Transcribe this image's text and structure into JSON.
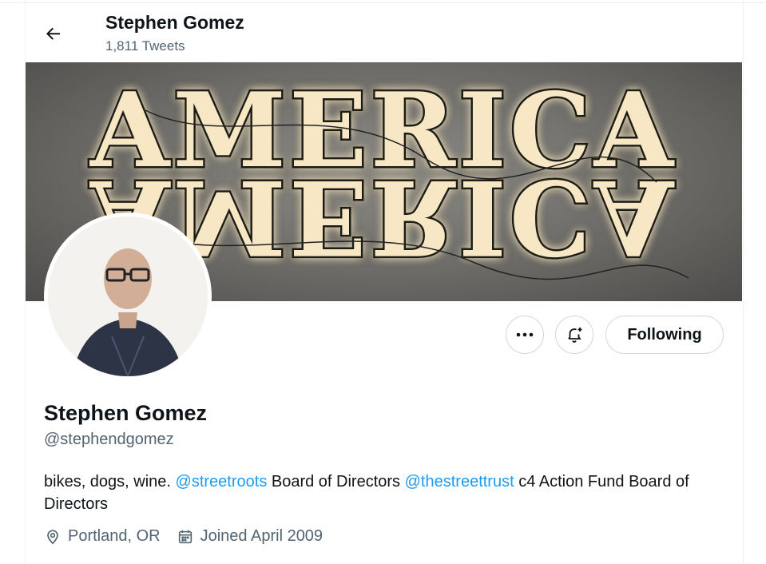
{
  "header": {
    "name": "Stephen Gomez",
    "tweet_count": "1,811 Tweets",
    "back_icon": "arrow-left-icon"
  },
  "banner": {
    "description_text_top": "AMERICA",
    "description_text_bottom": "AMERICA"
  },
  "actions": {
    "more_icon": "ellipsis-icon",
    "notify_icon": "bell-plus-icon",
    "follow_label": "Following"
  },
  "profile": {
    "name": "Stephen Gomez",
    "handle": "@stephendgomez",
    "bio": {
      "part1": "bikes, dogs, wine. ",
      "mention1": "@streetroots",
      "part2": " Board of Directors ",
      "mention2": "@thestreettrust",
      "part3": " c4 Action Fund Board of Directors"
    },
    "location": "Portland, OR",
    "joined": "Joined April 2009"
  },
  "colors": {
    "accent": "#1d9bf0",
    "secondary_text": "#536471",
    "border": "#cfd9de"
  }
}
